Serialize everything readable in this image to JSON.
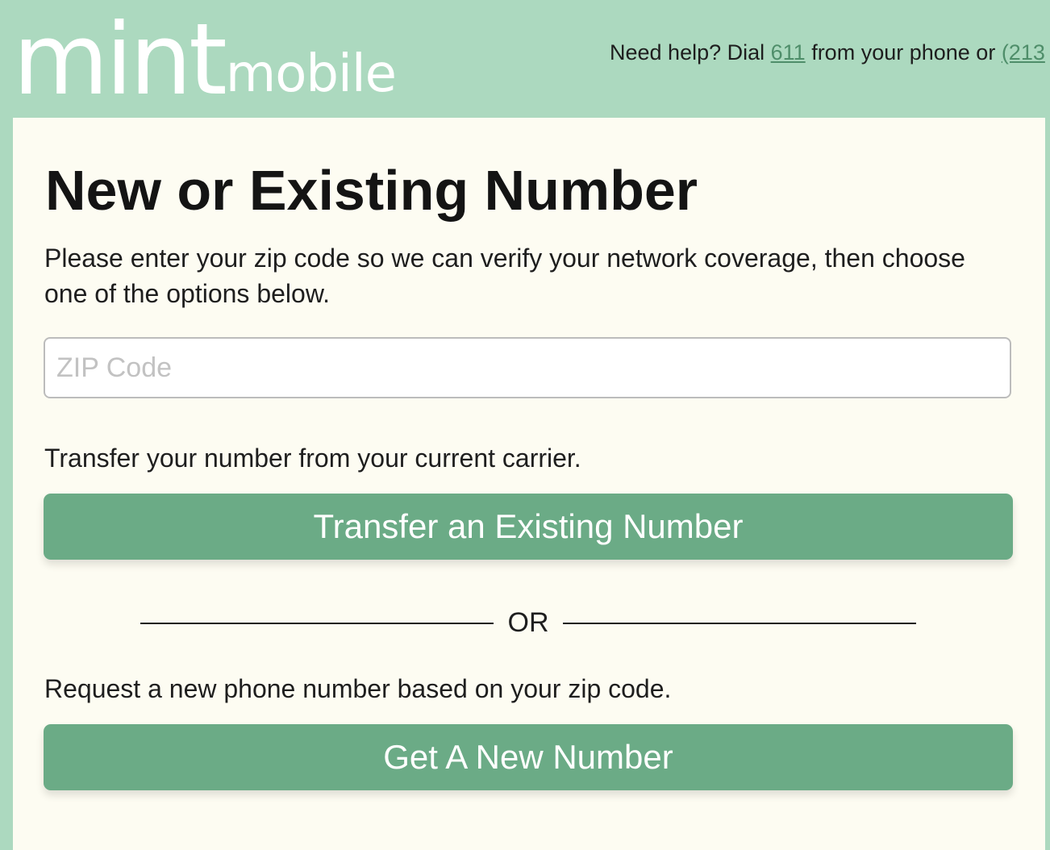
{
  "header": {
    "logo_mint": "mint",
    "logo_mobile": "mobile",
    "help_prefix": "Need help? Dial ",
    "help_short_code": "611",
    "help_middle": " from your phone or ",
    "help_phone": "(213"
  },
  "main": {
    "title": "New or Existing Number",
    "intro": "Please enter your zip code so we can verify your network coverage, then choose one of the options below.",
    "zip_placeholder": "ZIP Code",
    "zip_value": "",
    "transfer_text": "Transfer your number from your current carrier.",
    "transfer_button": "Transfer an Existing Number",
    "or_label": "OR",
    "new_text": "Request a new phone number based on your zip code.",
    "new_button": "Get A New Number"
  },
  "colors": {
    "header_bg": "#acd9bf",
    "card_bg": "#fdfcf2",
    "button_bg": "#6bab86",
    "link": "#4f8e6a"
  }
}
